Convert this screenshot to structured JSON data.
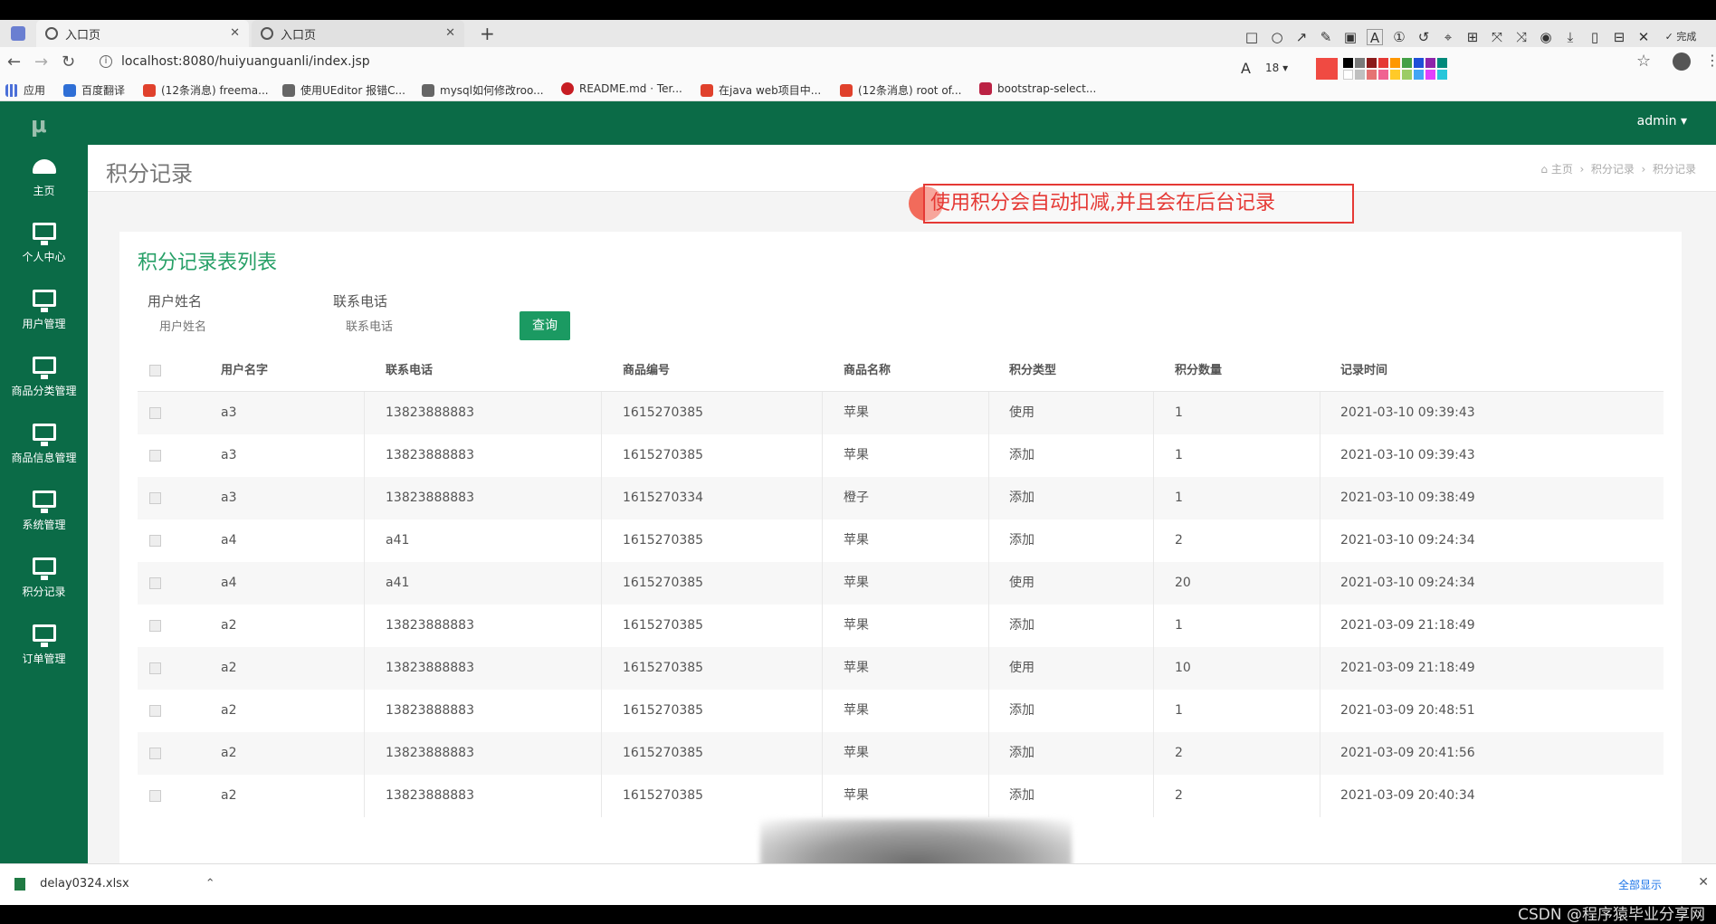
{
  "browser": {
    "tabs": [
      {
        "label": "入口页"
      },
      {
        "label": "入口页"
      }
    ],
    "url": "localhost:8080/huiyuanguanli/index.jsp",
    "bookmarks": [
      "应用",
      "百度翻译",
      "(12条消息) freema...",
      "使用UEditor 报错C...",
      "mysql如何修改roo...",
      "README.md · Ter...",
      "在java web项目中...",
      "(12条消息) root of...",
      "bootstrap-select..."
    ],
    "annotation_font_size": "18",
    "annotation_done": "完成"
  },
  "app": {
    "logo": "μ",
    "user": "admin ▾",
    "sidebar": [
      "主页",
      "个人中心",
      "用户管理",
      "商品分类管理",
      "商品信息管理",
      "系统管理",
      "积分记录",
      "订单管理"
    ]
  },
  "page": {
    "title": "积分记录",
    "breadcrumb": [
      "主页",
      "积分记录",
      "积分记录"
    ],
    "annotation_text": "使用积分会自动扣减,并且会在后台记录",
    "panel_title": "积分记录表列表",
    "filters": [
      {
        "label": "用户姓名",
        "placeholder": "用户姓名"
      },
      {
        "label": "联系电话",
        "placeholder": "联系电话"
      }
    ],
    "query_button": "查询"
  },
  "table": {
    "headers": [
      "用户名字",
      "联系电话",
      "商品编号",
      "商品名称",
      "积分类型",
      "积分数量",
      "记录时间"
    ],
    "rows": [
      [
        "a3",
        "13823888883",
        "1615270385",
        "苹果",
        "使用",
        "1",
        "2021-03-10 09:39:43"
      ],
      [
        "a3",
        "13823888883",
        "1615270385",
        "苹果",
        "添加",
        "1",
        "2021-03-10 09:39:43"
      ],
      [
        "a3",
        "13823888883",
        "1615270334",
        "橙子",
        "添加",
        "1",
        "2021-03-10 09:38:49"
      ],
      [
        "a4",
        "a41",
        "1615270385",
        "苹果",
        "添加",
        "2",
        "2021-03-10 09:24:34"
      ],
      [
        "a4",
        "a41",
        "1615270385",
        "苹果",
        "使用",
        "20",
        "2021-03-10 09:24:34"
      ],
      [
        "a2",
        "13823888883",
        "1615270385",
        "苹果",
        "添加",
        "1",
        "2021-03-09 21:18:49"
      ],
      [
        "a2",
        "13823888883",
        "1615270385",
        "苹果",
        "使用",
        "10",
        "2021-03-09 21:18:49"
      ],
      [
        "a2",
        "13823888883",
        "1615270385",
        "苹果",
        "添加",
        "1",
        "2021-03-09 20:48:51"
      ],
      [
        "a2",
        "13823888883",
        "1615270385",
        "苹果",
        "添加",
        "2",
        "2021-03-09 20:41:56"
      ],
      [
        "a2",
        "13823888883",
        "1615270385",
        "苹果",
        "添加",
        "2",
        "2021-03-09 20:40:34"
      ]
    ]
  },
  "download": {
    "file": "delay0324.xlsx",
    "show_all": "全部显示"
  },
  "watermark": "CSDN @程序猿毕业分享网",
  "colors": {
    "sidebar": "#0b6b47",
    "accent": "#1b9a62",
    "annotation": "#e53935"
  }
}
